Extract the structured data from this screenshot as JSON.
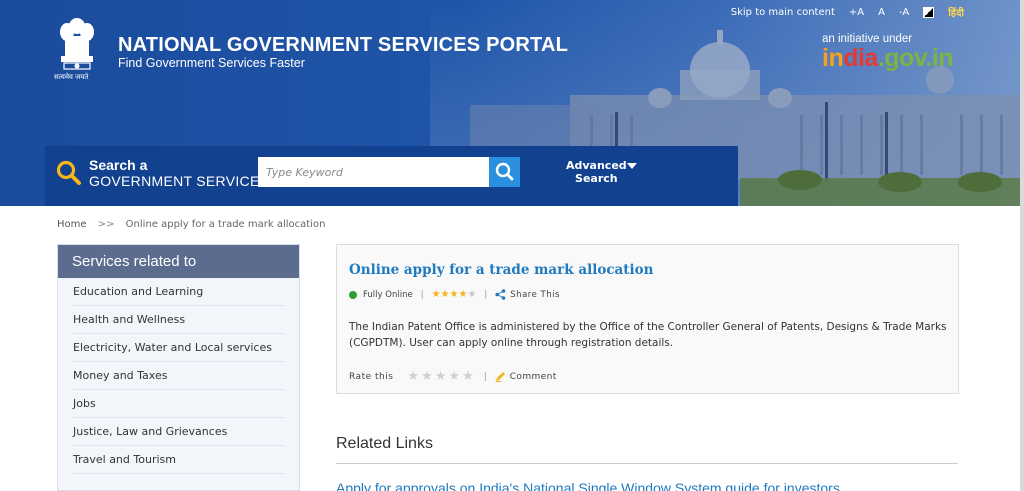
{
  "header": {
    "title": "NATIONAL GOVERNMENT SERVICES PORTAL",
    "subtitle": "Find Government Services Faster",
    "emblem_motto": "सत्यमेव जयते",
    "initiative_text": "an initiative under",
    "india_gov": {
      "part1": "in",
      "part2": "dia",
      "part3": ".gov.in"
    },
    "topbar": {
      "skip": "Skip to main content",
      "font_increase": "+A",
      "font_normal": "A",
      "font_decrease": "-A",
      "hindi": "हिंदी"
    }
  },
  "search": {
    "label_line1": "Search a",
    "label_line2": "GOVERNMENT SERVICE",
    "placeholder": "Type Keyword",
    "advanced_line1": "Advanced",
    "advanced_line2": "Search"
  },
  "breadcrumb": {
    "home": "Home",
    "separator": ">>",
    "current": "Online apply for a trade mark allocation"
  },
  "sidebar": {
    "heading": "Services related to",
    "items": [
      "Education and Learning",
      "Health and Wellness",
      "Electricity, Water and Local services",
      "Money and Taxes",
      "Jobs",
      "Justice, Law and Grievances",
      "Travel and Tourism"
    ]
  },
  "service": {
    "title": "Online apply for a trade mark allocation",
    "status": "Fully Online",
    "rating": 4,
    "rating_max": 5,
    "share": "Share This",
    "description": "The Indian Patent Office is administered by the Office of the Controller General of Patents, Designs & Trade Marks (CGPDTM). User can apply online through registration details.",
    "rate_label": "Rate this",
    "comment": "Comment"
  },
  "related": {
    "heading": "Related Links",
    "first_link": "Apply for approvals on India's National Single Window System guide for investors"
  },
  "colors": {
    "header_blue": "#1b4b9c",
    "search_band": "#11418f",
    "link_blue": "#1f7ac0",
    "status_green": "#2f9e32",
    "star_gold": "#f3b41b"
  }
}
